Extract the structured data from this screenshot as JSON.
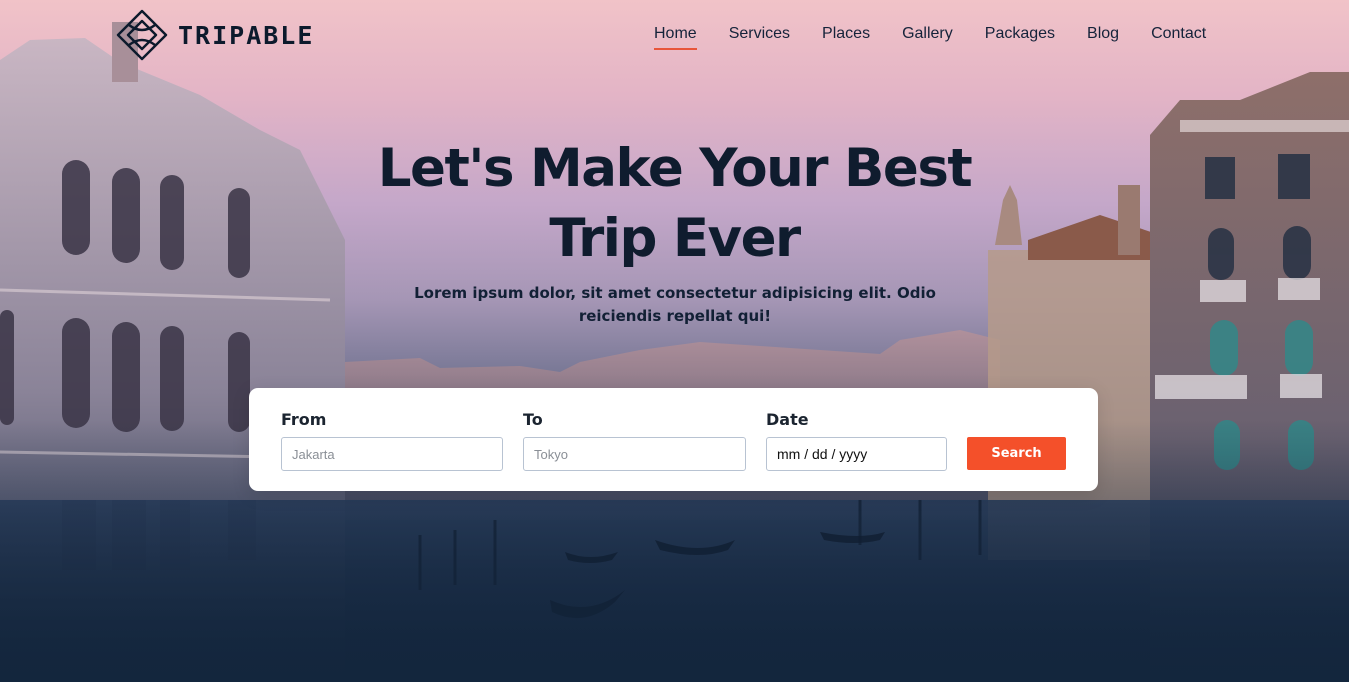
{
  "brand": {
    "name": "TRIPABLE",
    "logo_icon": "diamond-knot-icon"
  },
  "nav": {
    "items": [
      {
        "label": "Home",
        "active": true
      },
      {
        "label": "Services",
        "active": false
      },
      {
        "label": "Places",
        "active": false
      },
      {
        "label": "Gallery",
        "active": false
      },
      {
        "label": "Packages",
        "active": false
      },
      {
        "label": "Blog",
        "active": false
      },
      {
        "label": "Contact",
        "active": false
      }
    ]
  },
  "hero": {
    "title_line1": "Let's Make Your Best",
    "title_line2": "Trip Ever",
    "subtitle_line1": "Lorem ipsum dolor, sit amet consectetur adipisicing elit. Odio",
    "subtitle_line2": "reiciendis repellat qui!"
  },
  "search": {
    "from_label": "From",
    "from_placeholder": "Jakarta",
    "to_label": "To",
    "to_placeholder": "Tokyo",
    "date_label": "Date",
    "date_value": "mm / dd / yyyy",
    "button_label": "Search"
  },
  "colors": {
    "accent": "#f4502a",
    "text_dark": "#0f1c2e",
    "nav_underline": "#e8553a"
  }
}
